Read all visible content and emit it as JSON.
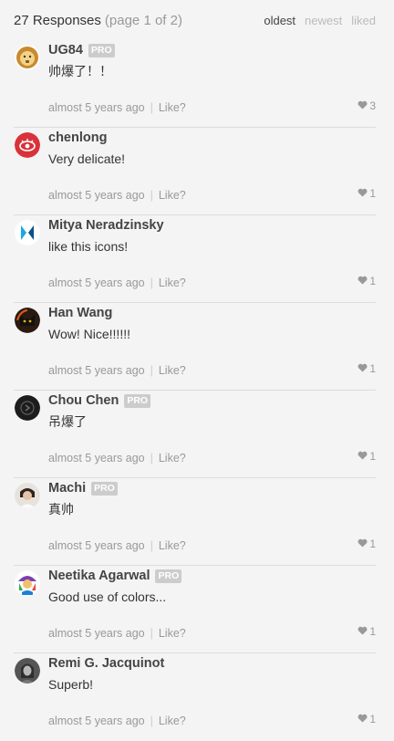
{
  "header": {
    "count": "27 Responses",
    "page": "(page 1 of 2)",
    "sort": [
      "oldest",
      "newest",
      "liked"
    ],
    "active_sort": "oldest"
  },
  "comments": [
    {
      "name": "UG84",
      "pro": "PRO",
      "text": "帅爆了！！",
      "time": "almost 5 years ago",
      "like": "Like?",
      "likes": "3",
      "avatar": "lion-avatar"
    },
    {
      "name": "chenlong",
      "pro": "",
      "text": "Very delicate!",
      "time": "almost 5 years ago",
      "like": "Like?",
      "likes": "1",
      "avatar": "eye-avatar"
    },
    {
      "name": "Mitya Neradzinsky",
      "pro": "",
      "text": "like this icons!",
      "time": "almost 5 years ago",
      "like": "Like?",
      "likes": "1",
      "avatar": "bowtie-logo-avatar"
    },
    {
      "name": "Han Wang",
      "pro": "",
      "text": "Wow! Nice!!!!!!",
      "time": "almost 5 years ago",
      "like": "Like?",
      "likes": "1",
      "avatar": "cat-avatar"
    },
    {
      "name": "Chou Chen",
      "pro": "PRO",
      "text": "吊爆了",
      "time": "almost 5 years ago",
      "like": "Like?",
      "likes": "1",
      "avatar": "dark-logo-avatar"
    },
    {
      "name": "Machi",
      "pro": "PRO",
      "text": "真帅",
      "time": "almost 5 years ago",
      "like": "Like?",
      "likes": "1",
      "avatar": "photo-avatar"
    },
    {
      "name": "Neetika Agarwal",
      "pro": "PRO",
      "text": "Good use of colors...",
      "time": "almost 5 years ago",
      "like": "Like?",
      "likes": "1",
      "avatar": "colorful-avatar"
    },
    {
      "name": "Remi G. Jacquinot",
      "pro": "",
      "text": "Superb!",
      "time": "almost 5 years ago",
      "like": "Like?",
      "likes": "1",
      "avatar": "portrait-avatar"
    }
  ],
  "colors": {
    "pro_badge": "#cccccc",
    "muted": "#999999",
    "background": "#f4f4f4"
  }
}
